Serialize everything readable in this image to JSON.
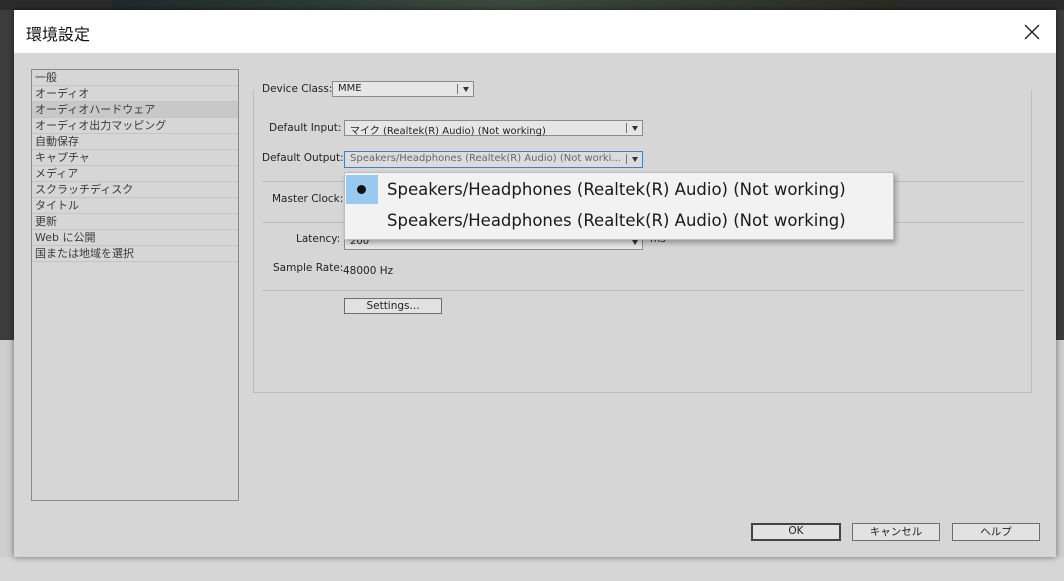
{
  "dialog": {
    "title": "環境設定"
  },
  "categories": [
    {
      "label": "一般"
    },
    {
      "label": "オーディオ"
    },
    {
      "label": "オーディオハードウェア",
      "selected": true
    },
    {
      "label": "オーディオ出力マッピング"
    },
    {
      "label": "自動保存"
    },
    {
      "label": "キャプチャ"
    },
    {
      "label": "メディア"
    },
    {
      "label": "スクラッチディスク"
    },
    {
      "label": "タイトル"
    },
    {
      "label": "更新"
    },
    {
      "label": "Web に公開"
    },
    {
      "label": "国または地域を選択"
    }
  ],
  "device_class": {
    "label": "Device Class:",
    "value": "MME"
  },
  "default_input": {
    "label": "Default Input:",
    "value": "マイク (Realtek(R) Audio) (Not working)"
  },
  "default_output": {
    "label": "Default Output:",
    "value": "Speakers/Headphones (Realtek(R) Audio) (Not worki..."
  },
  "master_clock": {
    "label": "Master Clock:"
  },
  "latency": {
    "label": "Latency:",
    "value": "200",
    "unit": "ms"
  },
  "sample_rate": {
    "label": "Sample Rate:",
    "value": "48000 Hz"
  },
  "settings_button": "Settings...",
  "output_dropdown": {
    "options": [
      {
        "label": "Speakers/Headphones (Realtek(R) Audio) (Not working)",
        "selected": true
      },
      {
        "label": "Speakers/Headphones (Realtek(R) Audio) (Not working)",
        "selected": false
      }
    ]
  },
  "footer": {
    "ok": "OK",
    "cancel": "キャンセル",
    "help": "ヘルプ"
  }
}
